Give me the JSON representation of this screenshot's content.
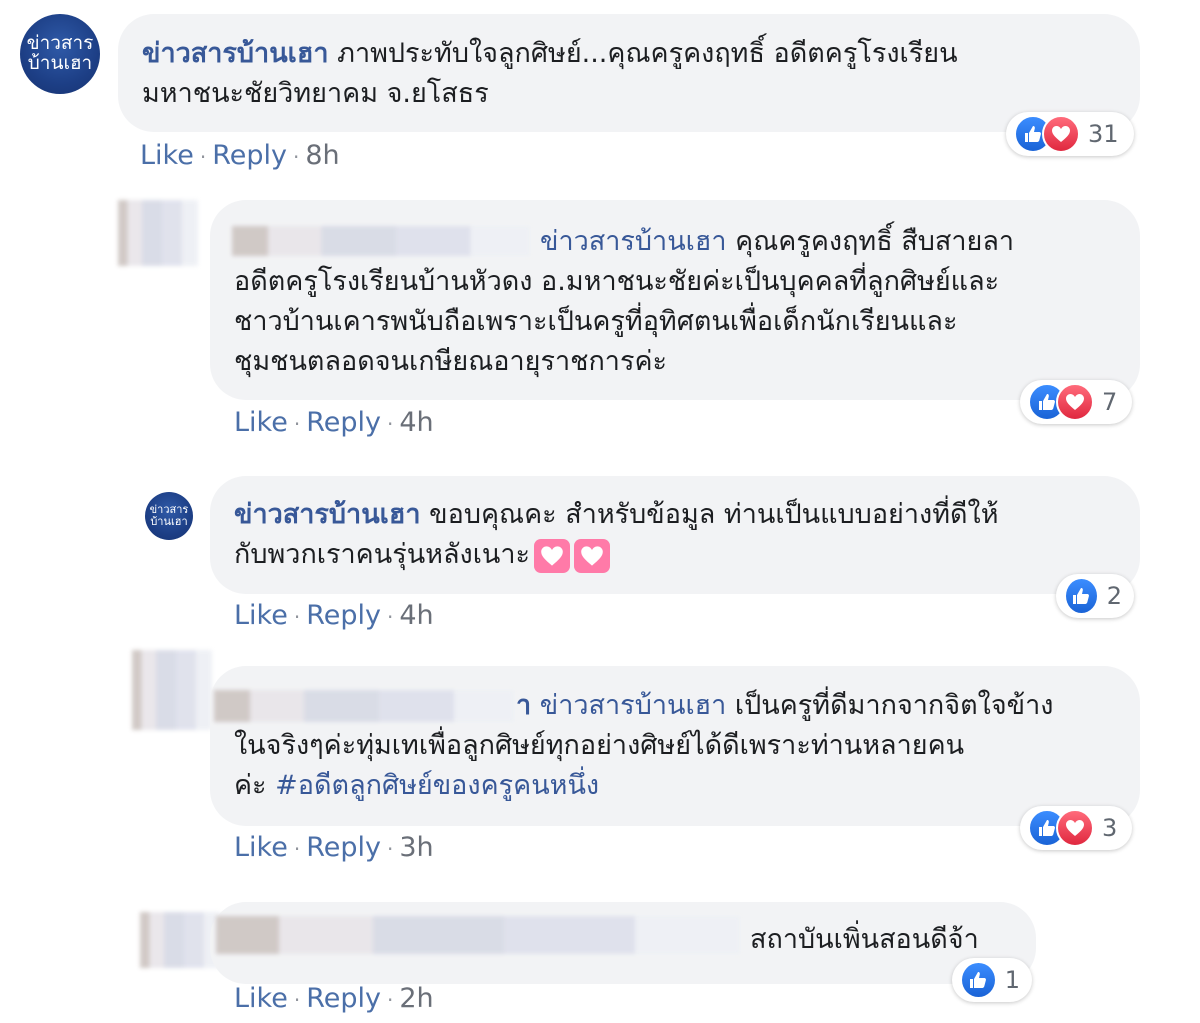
{
  "comments": [
    {
      "author": "ข่าวสารบ้านเฮา",
      "avatar_text": [
        "ข่าวสาร",
        "บ้านเฮา"
      ],
      "text_lines": [
        "ภาพประทับใจลูกศิษย์...คุณครูคงฤทธิ์ อดีตครูโรงเรียน",
        "มหาชนะชัยวิทยาคม จ.ยโสธร"
      ],
      "reaction_count": "31",
      "actions": {
        "like": "Like",
        "reply": "Reply",
        "time": "8h"
      }
    },
    {
      "tag": "ข่าวสารบ้านเฮา",
      "text_lines": [
        "คุณครูคงฤทธิ์ สืบสายลา",
        "อดีตครูโรงเรียนบ้านหัวดง อ.มหาชนะชัยค่ะเป็นบุคคลที่ลูกศิษย์และ",
        "ชาวบ้านเคารพนับถือเพราะเป็นครูที่อุทิศตนเพื่อเด็กนักเรียนและ",
        "ชุมชนตลอดจนเกษียณอายุราชการค่ะ"
      ],
      "reaction_count": "7",
      "actions": {
        "like": "Like",
        "reply": "Reply",
        "time": "4h"
      }
    },
    {
      "author": "ข่าวสารบ้านเฮา",
      "avatar_text": [
        "ข่าวสาร",
        "บ้านเฮา"
      ],
      "text_lines": [
        "ขอบคุณคะ สำหรับข้อมูล ท่านเป็นแบบอย่างที่ดีให้",
        "กับพวกเราคนรุ่นหลังเนาะ"
      ],
      "reaction_count": "2",
      "actions": {
        "like": "Like",
        "reply": "Reply",
        "time": "4h"
      }
    },
    {
      "name_tail": "า",
      "tag": "ข่าวสารบ้านเฮา",
      "text_lines": [
        "เป็นครูที่ดีมากจากจิตใจข้าง",
        "ในจริงๆค่ะทุ่มเทเพื่อลูกศิษย์ทุกอย่างศิษย์ได้ดีเพราะท่านหลายคน",
        "ค่ะ"
      ],
      "hashtag": "#อดีตลูกศิษย์ของครูคนหนึ่ง",
      "reaction_count": "3",
      "actions": {
        "like": "Like",
        "reply": "Reply",
        "time": "3h"
      }
    },
    {
      "text_lines": [
        "สถาบันเพิ่นสอนดีจ้า"
      ],
      "reaction_count": "1",
      "actions": {
        "like": "Like",
        "reply": "Reply",
        "time": "2h"
      }
    }
  ],
  "colors": {
    "name": "#385898",
    "bubble": "#f2f3f5",
    "like": "#1a63d6",
    "love": "#e0283f"
  },
  "icons": {
    "like": "thumbs-up-icon",
    "love": "heart-icon",
    "emoji": "heart-emoji-icon"
  }
}
